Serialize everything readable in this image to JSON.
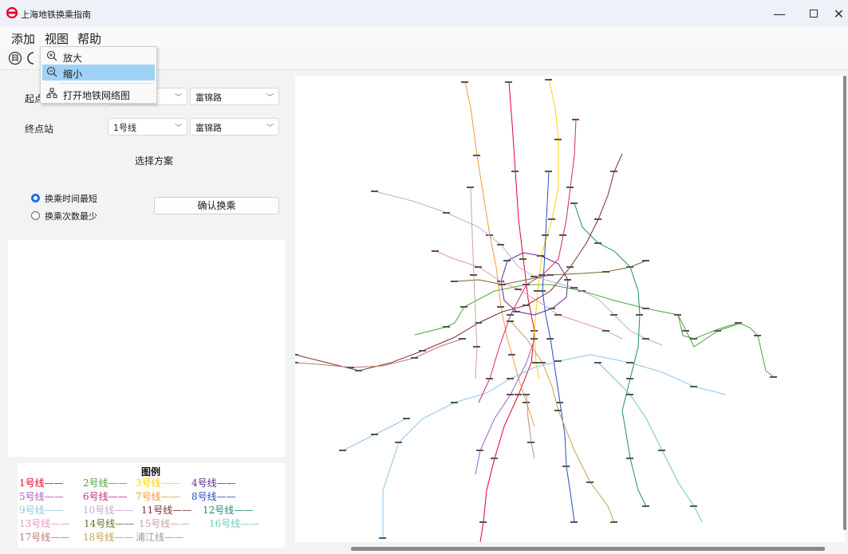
{
  "window": {
    "title": "上海地铁换乘指南"
  },
  "menu": {
    "add": "添加",
    "view": "视图",
    "help": "帮助"
  },
  "view_menu": [
    {
      "label": "放大",
      "icon": "zoom-in-icon"
    },
    {
      "label": "缩小",
      "icon": "zoom-out-icon",
      "highlighted": true
    },
    {
      "label": "打开地铁网络图",
      "icon": "network-icon"
    }
  ],
  "form": {
    "start_label": "起点",
    "start_station": "富锦路",
    "end_label": "终点站",
    "end_line": "1号线",
    "end_station": "富锦路",
    "plan_title": "选择方案",
    "option_fastest": "换乘时间最短",
    "option_fewest": "换乘次数最少",
    "confirm": "确认换乘"
  },
  "legend": {
    "title": "图例",
    "rows": [
      [
        {
          "t": "1号线——",
          "c": "#e3002b"
        },
        {
          "t": "2号线——",
          "c": "#4ca43a"
        },
        {
          "t": "3号线——",
          "c": "#ffd100"
        },
        {
          "t": "4号线——",
          "c": "#5a2d90"
        }
      ],
      [
        {
          "t": "5号线——",
          "c": "#a25ec8"
        },
        {
          "t": "6号线——",
          "c": "#d4237a"
        },
        {
          "t": "7号线——",
          "c": "#f39a33"
        },
        {
          "t": "8号线——",
          "c": "#2b49c9"
        }
      ],
      [
        {
          "t": "9号线——",
          "c": "#8fc5ea"
        },
        {
          "t": "10号线——",
          "c": "#c5a9d6"
        },
        {
          "t": "11号线——",
          "c": "#7e2b33"
        },
        {
          "t": "12号线——",
          "c": "#1b8f74"
        }
      ],
      [
        {
          "t": "13号线——",
          "c": "#e399b6"
        },
        {
          "t": "14号线——",
          "c": "#6b6b2e"
        },
        {
          "t": "15号线——",
          "c": "#c9a3a1"
        },
        {
          "t": "16号线——",
          "c": "#6fc9b5"
        }
      ],
      [
        {
          "t": "17号线——",
          "c": "#b77b70"
        },
        {
          "t": "18号线——",
          "c": "#c5a052"
        },
        {
          "t": "浦江线——",
          "c": "#9b9b9b"
        }
      ]
    ]
  },
  "colors": {
    "accent": "#1a73e8",
    "highlight": "#9fd2f5"
  }
}
